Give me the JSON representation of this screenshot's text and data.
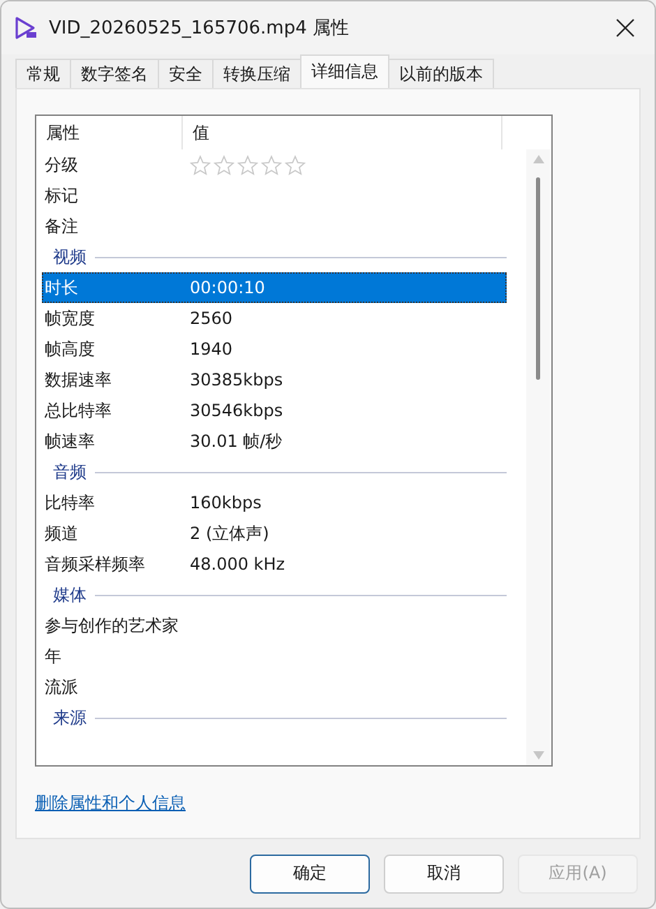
{
  "window": {
    "title": "VID_20260525_165706.mp4 属性"
  },
  "tabs": [
    {
      "label": "常规",
      "selected": false
    },
    {
      "label": "数字签名",
      "selected": false
    },
    {
      "label": "安全",
      "selected": false
    },
    {
      "label": "转换压缩",
      "selected": false
    },
    {
      "label": "详细信息",
      "selected": true
    },
    {
      "label": "以前的版本",
      "selected": false
    }
  ],
  "table": {
    "columns": [
      "属性",
      "值"
    ],
    "rows": [
      {
        "kind": "stars",
        "name": "分级",
        "stars": 0,
        "selected": false
      },
      {
        "kind": "row",
        "name": "标记",
        "selected": false
      },
      {
        "kind": "row",
        "name": "备注",
        "selected": false
      },
      {
        "kind": "group",
        "name": "视频"
      },
      {
        "kind": "row",
        "name": "时长",
        "value": "00:00:10",
        "selected": true
      },
      {
        "kind": "row",
        "name": "帧宽度",
        "value": "2560",
        "selected": false
      },
      {
        "kind": "row",
        "name": "帧高度",
        "value": "1940",
        "selected": false
      },
      {
        "kind": "row",
        "name": "数据速率",
        "value": "30385kbps",
        "selected": false
      },
      {
        "kind": "row",
        "name": "总比特率",
        "value": "30546kbps",
        "selected": false
      },
      {
        "kind": "row",
        "name": "帧速率",
        "value": "30.01 帧/秒",
        "selected": false
      },
      {
        "kind": "group",
        "name": "音频"
      },
      {
        "kind": "row",
        "name": "比特率",
        "value": "160kbps",
        "selected": false
      },
      {
        "kind": "row",
        "name": "频道",
        "value": "2 (立体声)",
        "selected": false
      },
      {
        "kind": "row",
        "name": "音频采样频率",
        "value": "48.000 kHz",
        "selected": false
      },
      {
        "kind": "group",
        "name": "媒体"
      },
      {
        "kind": "row",
        "name": "参与创作的艺术家",
        "selected": false
      },
      {
        "kind": "row",
        "name": "年",
        "selected": false
      },
      {
        "kind": "row",
        "name": "流派",
        "selected": false
      },
      {
        "kind": "group",
        "name": "来源"
      }
    ]
  },
  "link": "删除属性和个人信息",
  "buttons": [
    {
      "label": "确定",
      "default": true,
      "disabled": false
    },
    {
      "label": "取消",
      "default": false,
      "disabled": false
    },
    {
      "label": "应用(A)",
      "default": false,
      "disabled": true
    }
  ]
}
